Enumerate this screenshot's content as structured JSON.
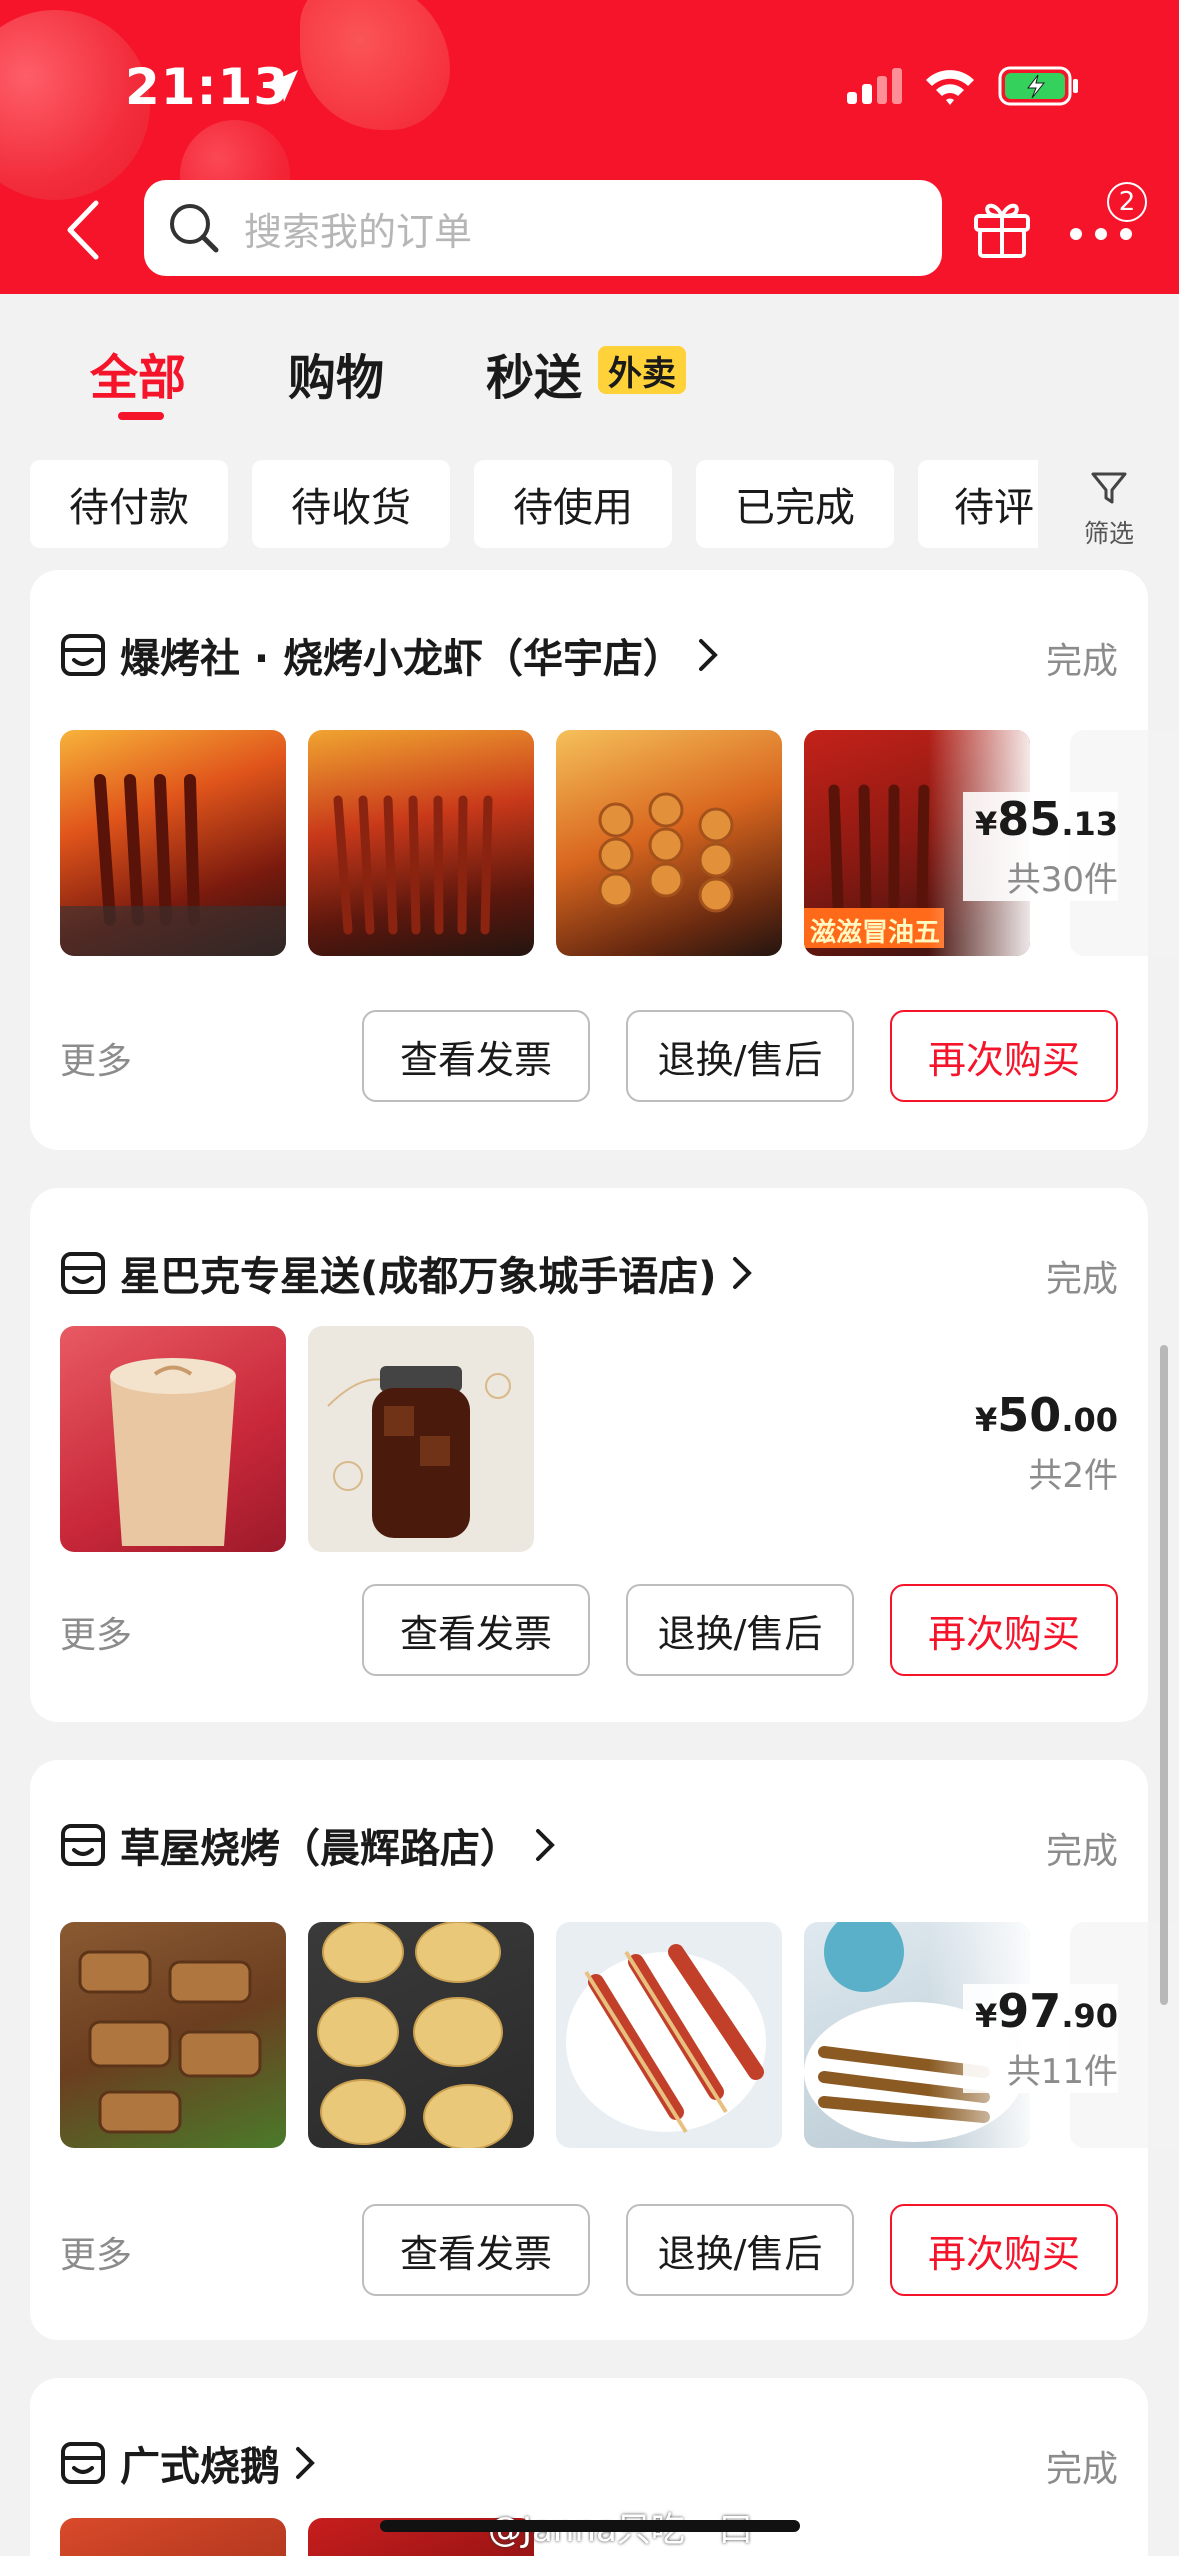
{
  "status_bar": {
    "time": "21:13"
  },
  "header": {
    "search_placeholder": "搜索我的订单",
    "more_badge": "2"
  },
  "tabs": [
    {
      "label": "全部",
      "active": true
    },
    {
      "label": "购物",
      "active": false
    },
    {
      "label": "秒送",
      "active": false,
      "badge": "外卖"
    }
  ],
  "filters": [
    "待付款",
    "待收货",
    "待使用",
    "已完成",
    "待评"
  ],
  "filter_button_label": "筛选",
  "orders": [
    {
      "shop": "爆烤社 · 烧烤小龙虾（华宇店）",
      "status": "完成",
      "price_yen": "¥",
      "price_int": "85",
      "price_dec": ".13",
      "quantity": "共30件",
      "more": "更多",
      "buttons": [
        "查看发票",
        "退换/售后",
        "再次购买"
      ]
    },
    {
      "shop": "星巴克专星送(成都万象城手语店)",
      "status": "完成",
      "price_yen": "¥",
      "price_int": "50",
      "price_dec": ".00",
      "quantity": "共2件",
      "more": "更多",
      "buttons": [
        "查看发票",
        "退换/售后",
        "再次购买"
      ]
    },
    {
      "shop": "草屋烧烤（晨辉路店）",
      "status": "完成",
      "price_yen": "¥",
      "price_int": "97",
      "price_dec": ".90",
      "quantity": "共11件",
      "more": "更多",
      "buttons": [
        "查看发票",
        "退换/售后",
        "再次购买"
      ]
    },
    {
      "shop": "广式烧鹅",
      "status": "完成"
    }
  ],
  "thumb_overlay_text": "滋滋冒油五",
  "watermark": "@Janna只吃一口",
  "colors": {
    "accent": "#f5142a",
    "tab_badge": "#ffd23a"
  }
}
